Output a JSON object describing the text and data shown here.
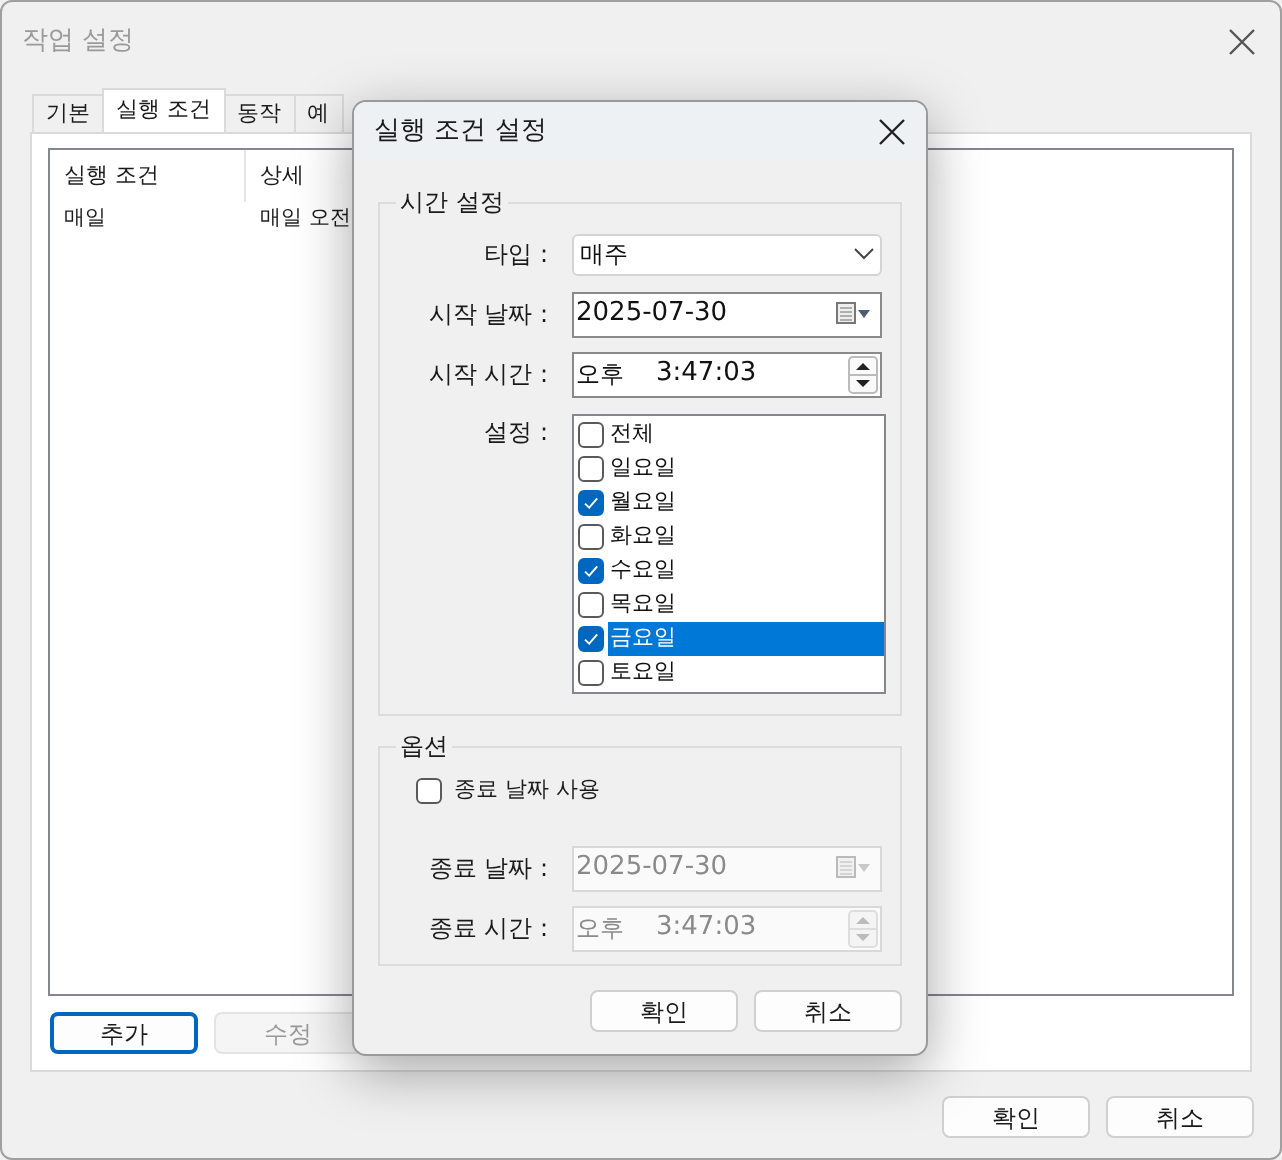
{
  "window": {
    "title": "작업 설정",
    "tabs": [
      {
        "label": "기본",
        "selected": false
      },
      {
        "label": "실행 조건",
        "selected": true
      },
      {
        "label": "동작",
        "selected": false
      },
      {
        "label": "예",
        "selected": false
      }
    ],
    "list": {
      "columns": [
        "실행 조건",
        "상세"
      ],
      "rows": [
        [
          "매일",
          "매일 오전"
        ]
      ]
    },
    "list_buttons": [
      {
        "label": "추가",
        "disabled": false,
        "focused": true
      },
      {
        "label": "수정",
        "disabled": true,
        "focused": false
      }
    ],
    "buttons": [
      "확인",
      "취소"
    ]
  },
  "dialog": {
    "title": "실행 조건 설정",
    "time_group": {
      "title": "시간 설정",
      "type": {
        "label": "타입 :",
        "value": "매주"
      },
      "start_date": {
        "label": "시작 날짜 :",
        "value": "2025-07-30",
        "disabled": false
      },
      "start_time": {
        "label": "시작 시간 :",
        "ampm": "오후",
        "value": "3:47:03",
        "disabled": false
      },
      "days": {
        "label": "설정 :",
        "items": [
          {
            "label": "전체",
            "checked": false,
            "selected": false
          },
          {
            "label": "일요일",
            "checked": false,
            "selected": false
          },
          {
            "label": "월요일",
            "checked": true,
            "selected": false
          },
          {
            "label": "화요일",
            "checked": false,
            "selected": false
          },
          {
            "label": "수요일",
            "checked": true,
            "selected": false
          },
          {
            "label": "목요일",
            "checked": false,
            "selected": false
          },
          {
            "label": "금요일",
            "checked": true,
            "selected": true
          },
          {
            "label": "토요일",
            "checked": false,
            "selected": false
          }
        ]
      }
    },
    "options_group": {
      "title": "옵션",
      "use_end_date": {
        "label": "종료 날짜 사용",
        "checked": false
      },
      "end_date": {
        "label": "종료 날짜 :",
        "value": "2025-07-30",
        "disabled": true
      },
      "end_time": {
        "label": "종료 시간 :",
        "ampm": "오후",
        "value": "3:47:03",
        "disabled": true
      }
    },
    "buttons": [
      "확인",
      "취소"
    ]
  }
}
